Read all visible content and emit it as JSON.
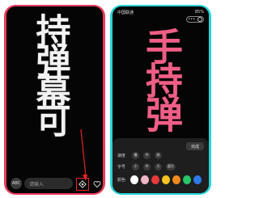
{
  "left_phone": {
    "danmaku_text": "持弹幕可",
    "abc_label": "ABC",
    "input_placeholder": "请输入"
  },
  "right_phone": {
    "status_left": "中国联通",
    "status_right": "85%",
    "danmaku_text": "手持弹",
    "done_label": "完成",
    "speed_label": "速度",
    "size_label": "字号",
    "color_label": "颜色",
    "speed_options": [
      "慢",
      "中",
      "快"
    ],
    "size_options": [
      "小",
      "中",
      "大",
      "超大"
    ],
    "colors": [
      "#ffffff",
      "#f1b6c4",
      "#e83a3a",
      "#f5c31f",
      "#f08b1f",
      "#26c86a",
      "#2d79e8"
    ]
  },
  "accent_colors": {
    "left_frame": "#ea3a5b",
    "right_frame": "#26d4d8",
    "highlight": "#e52525"
  }
}
